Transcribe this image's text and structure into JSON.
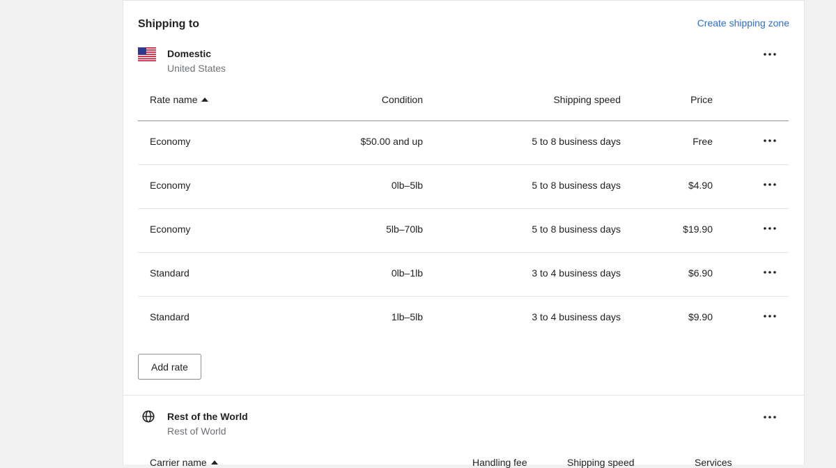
{
  "header": {
    "title": "Shipping to",
    "create_link": "Create shipping zone"
  },
  "domestic": {
    "name": "Domestic",
    "subtitle": "United States",
    "flag_icon": "us-flag-icon",
    "columns": {
      "rate_name": "Rate name",
      "condition": "Condition",
      "speed": "Shipping speed",
      "price": "Price"
    },
    "rates": [
      {
        "name": "Economy",
        "condition": "$50.00 and up",
        "speed": "5 to 8 business days",
        "price": "Free"
      },
      {
        "name": "Economy",
        "condition": "0lb–5lb",
        "speed": "5 to 8 business days",
        "price": "$4.90"
      },
      {
        "name": "Economy",
        "condition": "5lb–70lb",
        "speed": "5 to 8 business days",
        "price": "$19.90"
      },
      {
        "name": "Standard",
        "condition": "0lb–1lb",
        "speed": "3 to 4 business days",
        "price": "$6.90"
      },
      {
        "name": "Standard",
        "condition": "1lb–5lb",
        "speed": "3 to 4 business days",
        "price": "$9.90"
      }
    ],
    "add_rate_label": "Add rate"
  },
  "rest_of_world": {
    "name": "Rest of the World",
    "subtitle": "Rest of World",
    "globe_icon": "globe-icon",
    "columns": {
      "carrier_name": "Carrier name",
      "handling_fee": "Handling fee",
      "speed": "Shipping speed",
      "services": "Services"
    }
  },
  "icons": {
    "more": "more-horizontal-icon",
    "sort": "sort-ascending-icon"
  },
  "colors": {
    "link": "#2c6ecb",
    "background": "#f1f1f1",
    "card": "#ffffff",
    "text": "#202223",
    "subdued": "#6d7175"
  }
}
